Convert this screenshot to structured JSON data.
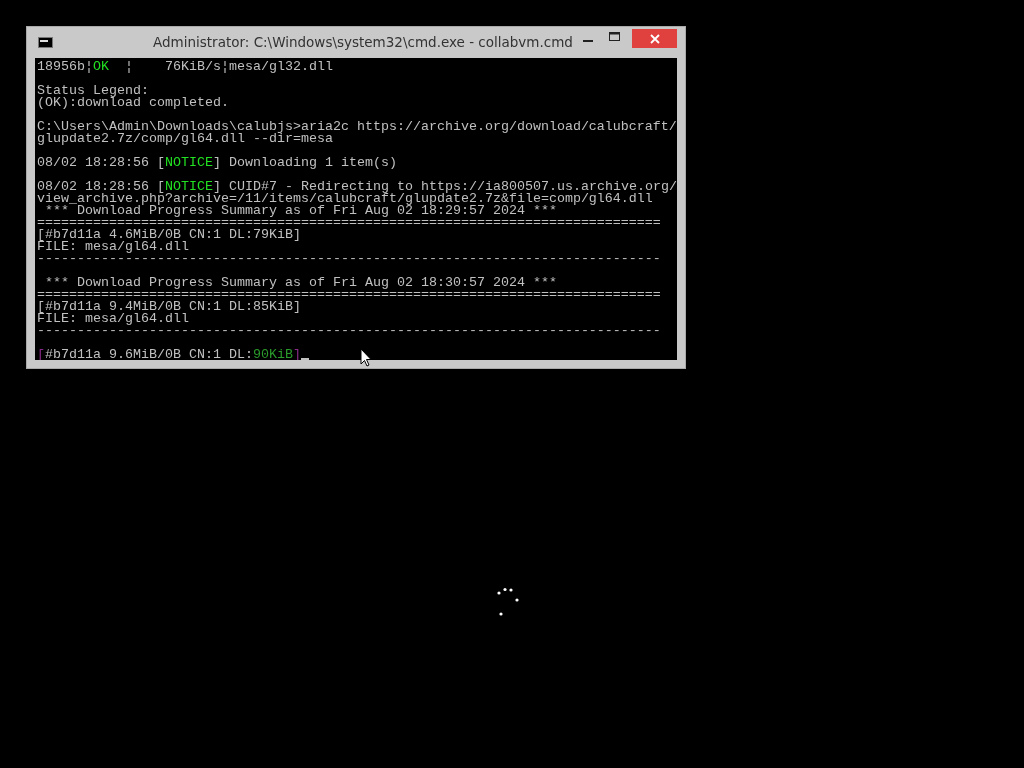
{
  "window": {
    "title": "Administrator: C:\\Windows\\system32\\cmd.exe - collabvm.cmd"
  },
  "console": {
    "blocks": [
      [
        {
          "segments": [
            {
              "text": "18956b¦"
            },
            {
              "text": "OK",
              "color": "#22e022"
            },
            {
              "text": "  ¦    76KiB/s¦mesa/gl32.dll"
            }
          ]
        }
      ],
      [
        {
          "segments": [
            {
              "text": "Status Legend:"
            }
          ]
        },
        {
          "segments": [
            {
              "text": "(OK):download completed."
            }
          ]
        }
      ],
      [
        {
          "segments": [
            {
              "text": "C:\\Users\\Admin\\Downloads\\calubjs>aria2c https://archive.org/download/calubcraft/"
            }
          ]
        },
        {
          "segments": [
            {
              "text": "glupdate2.7z/comp/gl64.dll --dir=mesa"
            }
          ]
        }
      ],
      [
        {
          "segments": [
            {
              "text": "08/02 18:28:56 ["
            },
            {
              "text": "NOTICE",
              "color": "#22e022"
            },
            {
              "text": "] Downloading 1 item(s)"
            }
          ]
        }
      ],
      [
        {
          "segments": [
            {
              "text": "08/02 18:28:56 ["
            },
            {
              "text": "NOTICE",
              "color": "#22e022"
            },
            {
              "text": "] CUID#7 - Redirecting to https://ia800507.us.archive.org/"
            }
          ]
        },
        {
          "segments": [
            {
              "text": "view_archive.php?archive=/11/items/calubcraft/glupdate2.7z&file=comp/gl64.dll"
            }
          ]
        },
        {
          "segments": [
            {
              "text": " *** Download Progress Summary as of Fri Aug 02 18:29:57 2024 ***"
            }
          ]
        },
        {
          "segments": [
            {
              "text": "=============================================================================="
            }
          ]
        },
        {
          "segments": [
            {
              "text": "[#b7d11a 4.6MiB/0B CN:1 DL:79KiB]"
            }
          ]
        },
        {
          "segments": [
            {
              "text": "FILE: mesa/gl64.dll"
            }
          ]
        },
        {
          "segments": [
            {
              "text": "------------------------------------------------------------------------------"
            }
          ]
        }
      ],
      [
        {
          "segments": [
            {
              "text": " *** Download Progress Summary as of Fri Aug 02 18:30:57 2024 ***"
            }
          ]
        },
        {
          "segments": [
            {
              "text": "=============================================================================="
            }
          ]
        },
        {
          "segments": [
            {
              "text": "[#b7d11a 9.4MiB/0B CN:1 DL:85KiB]"
            }
          ]
        },
        {
          "segments": [
            {
              "text": "FILE: mesa/gl64.dll"
            }
          ]
        },
        {
          "segments": [
            {
              "text": "------------------------------------------------------------------------------"
            }
          ]
        }
      ],
      [
        {
          "segments": [
            {
              "text": "[",
              "color": "#8a2a8a"
            },
            {
              "text": "#b7d11a 9.6MiB/0B CN:1 DL:"
            },
            {
              "text": "90KiB",
              "color": "#2a9a2a"
            },
            {
              "text": "]",
              "color": "#8a2a8a"
            }
          ],
          "cursor": true
        }
      ]
    ]
  }
}
